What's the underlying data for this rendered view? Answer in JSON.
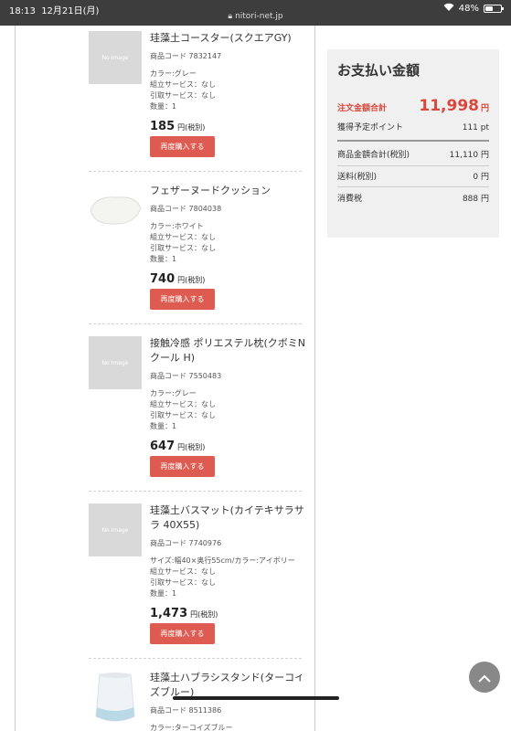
{
  "status": {
    "time": "18:13",
    "date": "12月21日(月)",
    "url": "nitori-net.jp",
    "battery": "48%",
    "battery_level": 0.48
  },
  "items": [
    {
      "thumb": "No Image",
      "name": "珪藻土コースター(スクエアGY)",
      "code": "商品コード 7832147",
      "attrs": [
        "カラー:グレー",
        "組立サービス：なし",
        "引取サービス：なし",
        "数量：1"
      ],
      "price": "185",
      "price_unit": "円(税別)",
      "button": "再度購入する"
    },
    {
      "thumb": "",
      "name": "フェザーヌードクッション",
      "code": "商品コード 7804038",
      "attrs": [
        "カラー:ホワイト",
        "組立サービス：なし",
        "引取サービス：なし",
        "数量：1"
      ],
      "price": "740",
      "price_unit": "円(税別)",
      "button": "再度購入する"
    },
    {
      "thumb": "No Image",
      "name": "接触冷感 ポリエステル枕(クボミNクール H)",
      "code": "商品コード 7550483",
      "attrs": [
        "カラー:グレー",
        "組立サービス：なし",
        "引取サービス：なし",
        "数量：1"
      ],
      "price": "647",
      "price_unit": "円(税別)",
      "button": "再度購入する"
    },
    {
      "thumb": "No Image",
      "name": "珪藻土バスマット(カイテキサラサラ 40X55)",
      "code": "商品コード 7740976",
      "attrs": [
        "サイズ:幅40×奥行55cm/カラー:アイボリー",
        "組立サービス：なし",
        "引取サービス：なし",
        "数量：1"
      ],
      "price": "1,473",
      "price_unit": "円(税別)",
      "button": "再度購入する"
    },
    {
      "thumb": "",
      "name": "珪藻土ハブラシスタンド(ターコイズブルー)",
      "code": "商品コード 8511386",
      "attrs": [
        "カラー:ターコイズブルー"
      ],
      "price": "",
      "price_unit": "",
      "button": ""
    }
  ],
  "summary": {
    "title": "お支払い金額",
    "total_label": "注文金額合計",
    "total_value": "11,998",
    "total_unit": "円",
    "points_label": "獲得予定ポイント",
    "points_value": "111 pt",
    "subtotal_label": "商品金額合計(税別)",
    "subtotal_value": "11,110 円",
    "shipping_label": "送料(税別)",
    "shipping_value": "0 円",
    "tax_label": "消費税",
    "tax_value": "888 円"
  },
  "colors": {
    "accent": "#d9483c",
    "button": "#dd5b50"
  }
}
